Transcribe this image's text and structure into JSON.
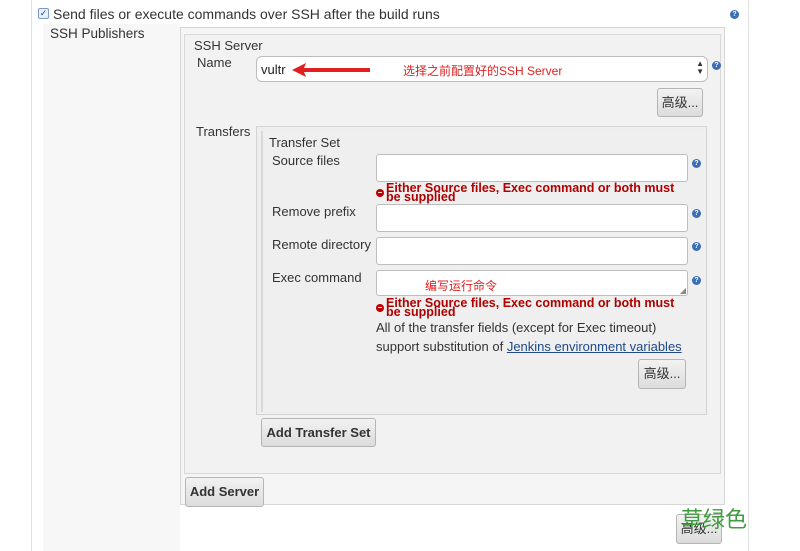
{
  "header": {
    "checkbox_label": "Send files or execute commands over SSH after the build runs"
  },
  "ssh_publishers": {
    "label": "SSH Publishers",
    "server": {
      "title": "SSH Server",
      "name_label": "Name",
      "name_value": "vultr",
      "name_annotation": "选择之前配置好的SSH Server",
      "advanced_button": "高级..."
    },
    "transfers": {
      "label": "Transfers",
      "set_title": "Transfer Set",
      "source_files_label": "Source files",
      "source_files_value": "",
      "error_line1": "Either Source files, Exec command or both must",
      "error_line2": "be supplied",
      "remove_prefix_label": "Remove prefix",
      "remote_directory_label": "Remote directory",
      "exec_command_label": "Exec command",
      "exec_command_annotation": "编写运行命令",
      "info_line1": "All of the transfer fields (except for Exec timeout)",
      "info_line2_prefix": "support substitution of ",
      "info_link": "Jenkins environment variables",
      "advanced_button": "高级...",
      "add_transfer_set_button": "Add Transfer Set"
    },
    "add_server_button": "Add Server",
    "bottom_advanced_button": "高级..."
  },
  "watermark": "草绿色",
  "colors": {
    "error": "#b00000",
    "annotation": "#e02020",
    "link": "#204a87",
    "watermark": "#3f9b3f"
  }
}
